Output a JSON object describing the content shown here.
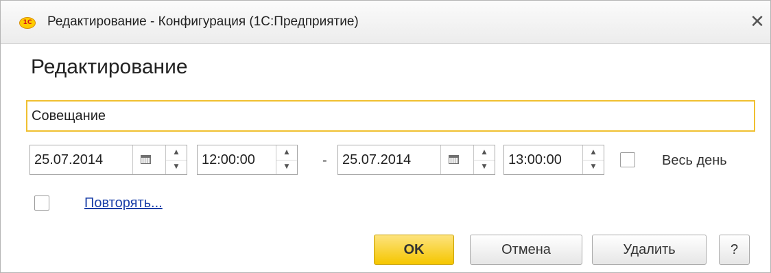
{
  "window": {
    "title": "Редактирование - Конфигурация  (1С:Предприятие)",
    "logo_text": "1С",
    "close_symbol": "✕"
  },
  "form": {
    "heading": "Редактирование",
    "subject_value": "Совещание",
    "start_date": "25.07.2014",
    "start_time": "12:00:00",
    "separator": "-",
    "end_date": "25.07.2014",
    "end_time": "13:00:00",
    "all_day_label": "Весь день",
    "all_day_checked": false,
    "repeat_checked": false,
    "repeat_link": "Повторять..."
  },
  "buttons": {
    "ok": "OK",
    "cancel": "Отмена",
    "delete": "Удалить",
    "help": "?"
  },
  "icons": {
    "calendar": "calendar-icon",
    "spin_up": "▲",
    "spin_down": "▼"
  },
  "colors": {
    "accent_border": "#f0c030",
    "primary_button": "#f5c600",
    "link": "#1a3fa8"
  }
}
